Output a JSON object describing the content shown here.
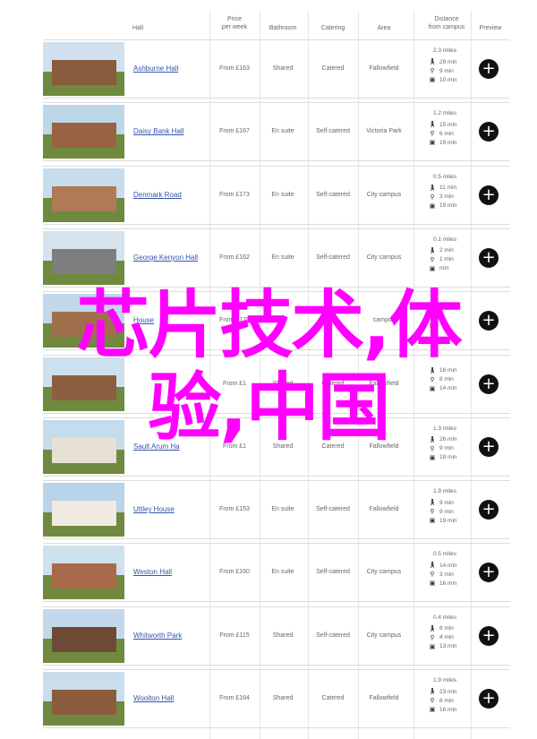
{
  "header": {
    "hall": "Hall",
    "price_line1": "Price",
    "price_line2": "per week",
    "bathroom": "Bathroom",
    "catering": "Catering",
    "area": "Area",
    "distance_line1": "Distance",
    "distance_line2": "from campus",
    "preview": "Preview"
  },
  "rows": [
    {
      "name": "Ashburne Hall",
      "price": "From £163",
      "bathroom": "Shared",
      "catering": "Catered",
      "area": "Fallowfield",
      "miles": "2.3 miles",
      "walk": "29 min",
      "cycle": "9 min",
      "bus": "10 min"
    },
    {
      "name": "Daisy Bank Hall",
      "price": "From £167",
      "bathroom": "En suite",
      "catering": "Self-catered",
      "area": "Victoria Park",
      "miles": "1.2 miles",
      "walk": "15 min",
      "cycle": "6 min",
      "bus": "19 min"
    },
    {
      "name": "Denmark Road",
      "price": "From £173",
      "bathroom": "En suite",
      "catering": "Self-catered",
      "area": "City campus",
      "miles": "0.5 miles",
      "walk": "11 min",
      "cycle": "3 min",
      "bus": "19 min"
    },
    {
      "name": "George Kenyon Hall",
      "price": "From £162",
      "bathroom": "En suite",
      "catering": "Self-catered",
      "area": "City campus",
      "miles": "0.1 miles",
      "walk": "2 min",
      "cycle": "1 min",
      "bus": "min"
    },
    {
      "name": "House",
      "price": "From £179",
      "bathroom": "",
      "catering": "",
      "area": "campus",
      "miles": "",
      "walk": "",
      "cycle": "",
      "bus": ""
    },
    {
      "name": "",
      "price": "From £1",
      "bathroom": "Shared",
      "catering": "Catered",
      "area": "Fallowfield",
      "miles": "",
      "walk": "16 min",
      "cycle": "8 min",
      "bus": "14 min"
    },
    {
      "name": "Sault Arum Ha",
      "price": "From £1",
      "bathroom": "Shared",
      "catering": "Catered",
      "area": "Fallowfield",
      "miles": "1.3 miles",
      "walk": "26 min",
      "cycle": "9 min",
      "bus": "18 min"
    },
    {
      "name": "Uttley House",
      "price": "From £153",
      "bathroom": "En suite",
      "catering": "Self-catered",
      "area": "Fallowfield",
      "miles": "1.9 miles",
      "walk": "9 min",
      "cycle": "9 min",
      "bus": "19 min"
    },
    {
      "name": "Weston Hall",
      "price": "From £160",
      "bathroom": "En suite",
      "catering": "Self-catered",
      "area": "City campus",
      "miles": "0.5 miles",
      "walk": "14 min",
      "cycle": "3 min",
      "bus": "16 min"
    },
    {
      "name": "Whitworth Park",
      "price": "From £115",
      "bathroom": "Shared",
      "catering": "Self-catered",
      "area": "City campus",
      "miles": "0.4 miles",
      "walk": "8 min",
      "cycle": "4 min",
      "bus": "13 min"
    },
    {
      "name": "Woolton Hall",
      "price": "From £164",
      "bathroom": "Shared",
      "catering": "Catered",
      "area": "Fallowfield",
      "miles": "1.9 miles",
      "walk": "23 min",
      "cycle": "8 min",
      "bus": "16 min"
    }
  ],
  "overlay": {
    "line1": "芯片技术,体",
    "line2": "验,中国"
  },
  "colors": {
    "link": "#3355aa",
    "overlay": "#ff00ff",
    "preview_button": "#111111"
  },
  "icons": {
    "walk": "walk-icon",
    "cycle": "cycle-icon",
    "bus": "bus-icon",
    "preview": "plus-icon"
  }
}
